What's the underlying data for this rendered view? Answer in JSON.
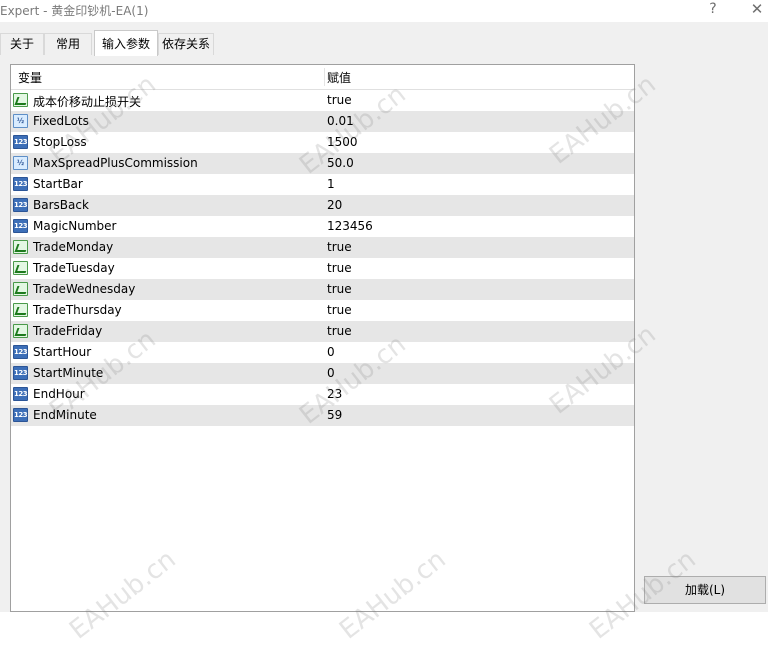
{
  "window": {
    "title": "Expert - 黄金印钞机-EA(1)",
    "help_glyph": "?",
    "close_glyph": "✕"
  },
  "tabs": [
    {
      "label": "关于",
      "active": false
    },
    {
      "label": "常用",
      "active": false
    },
    {
      "label": "输入参数",
      "active": true
    },
    {
      "label": "依存关系",
      "active": false
    }
  ],
  "grid": {
    "columns": {
      "name": "变量",
      "value": "赋值"
    },
    "rows": [
      {
        "type": "bool",
        "name": "成本价移动止损开关",
        "value": "true"
      },
      {
        "type": "double",
        "name": "FixedLots",
        "value": "0.01"
      },
      {
        "type": "int",
        "name": "StopLoss",
        "value": "1500"
      },
      {
        "type": "double",
        "name": "MaxSpreadPlusCommission",
        "value": "50.0"
      },
      {
        "type": "int",
        "name": "StartBar",
        "value": "1"
      },
      {
        "type": "int",
        "name": "BarsBack",
        "value": "20"
      },
      {
        "type": "int",
        "name": "MagicNumber",
        "value": "123456"
      },
      {
        "type": "bool",
        "name": "TradeMonday",
        "value": "true"
      },
      {
        "type": "bool",
        "name": "TradeTuesday",
        "value": "true"
      },
      {
        "type": "bool",
        "name": "TradeWednesday",
        "value": "true"
      },
      {
        "type": "bool",
        "name": "TradeThursday",
        "value": "true"
      },
      {
        "type": "bool",
        "name": "TradeFriday",
        "value": "true"
      },
      {
        "type": "int",
        "name": "StartHour",
        "value": "0"
      },
      {
        "type": "int",
        "name": "StartMinute",
        "value": "0"
      },
      {
        "type": "int",
        "name": "EndHour",
        "value": "23"
      },
      {
        "type": "int",
        "name": "EndMinute",
        "value": "59"
      }
    ],
    "icon_text": {
      "int": "123",
      "double": "½"
    }
  },
  "buttons": {
    "load": "加载(L)"
  },
  "watermark": "EAHub.cn"
}
